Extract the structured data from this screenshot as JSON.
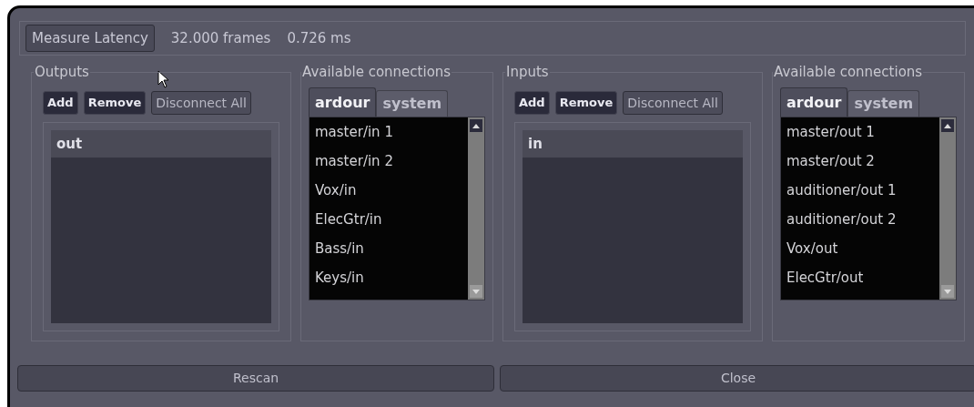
{
  "toolbar": {
    "measure_button": "Measure Latency",
    "frames": "32.000 frames",
    "time": "0.726 ms"
  },
  "sections": [
    {
      "ports": {
        "title": "Outputs",
        "buttons": [
          "Add",
          "Remove",
          "Disconnect All"
        ],
        "list_header": "out"
      },
      "available": {
        "title": "Available connections",
        "tabs": [
          {
            "label": "ardour",
            "selected": true
          },
          {
            "label": "system",
            "selected": false
          }
        ],
        "items": [
          "master/in 1",
          "master/in 2",
          "Vox/in",
          "ElecGtr/in",
          "Bass/in",
          "Keys/in"
        ]
      }
    },
    {
      "ports": {
        "title": "Inputs",
        "buttons": [
          "Add",
          "Remove",
          "Disconnect All"
        ],
        "list_header": "in"
      },
      "available": {
        "title": "Available connections",
        "tabs": [
          {
            "label": "ardour",
            "selected": true
          },
          {
            "label": "system",
            "selected": false
          }
        ],
        "items": [
          "master/out 1",
          "master/out 2",
          "auditioner/out 1",
          "auditioner/out 2",
          "Vox/out",
          "ElecGtr/out"
        ]
      }
    }
  ],
  "footer_buttons": [
    "Rescan",
    "Close"
  ]
}
